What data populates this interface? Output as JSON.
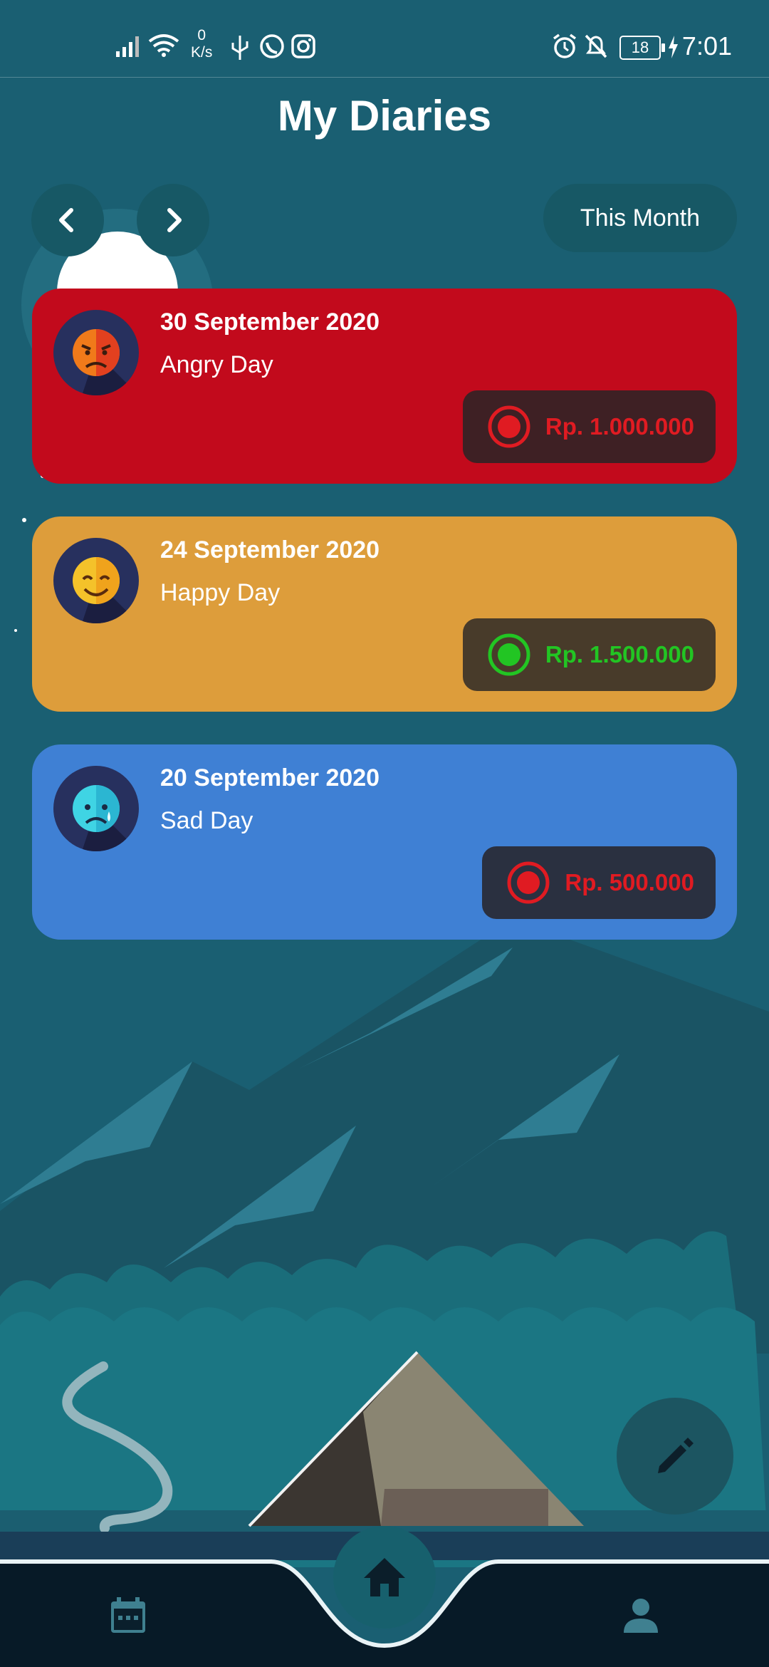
{
  "status_bar": {
    "net_speed_value": "0",
    "net_speed_unit": "K/s",
    "battery": "18",
    "time": "7:01"
  },
  "header": {
    "title": "My Diaries"
  },
  "filter": {
    "period_label": "This Month"
  },
  "diaries": [
    {
      "date": "30 September 2020",
      "label": "Angry Day",
      "amount": "Rp. 1.000.000",
      "card_color": "#c20a1c",
      "amount_color": "#e01b22",
      "amount_type": "expense",
      "mood_icon": "angry-face-icon"
    },
    {
      "date": "24 September 2020",
      "label": "Happy Day",
      "amount": "Rp. 1.500.000",
      "card_color": "#dd9d3b",
      "amount_color": "#22c523",
      "amount_type": "income",
      "mood_icon": "happy-face-icon"
    },
    {
      "date": "20 September 2020",
      "label": "Sad Day",
      "amount": "Rp. 500.000",
      "card_color": "#3f80d4",
      "amount_color": "#e01b22",
      "amount_type": "expense",
      "mood_icon": "sad-face-icon"
    }
  ],
  "nav": {
    "prev_icon": "chevron-left-icon",
    "next_icon": "chevron-right-icon",
    "fab_icon": "pencil-icon",
    "items": [
      "calendar-icon",
      "home-icon",
      "profile-icon"
    ]
  },
  "colors": {
    "background": "#1a5f72",
    "nav_button": "#175865",
    "bottom_bar": "#071a27"
  }
}
